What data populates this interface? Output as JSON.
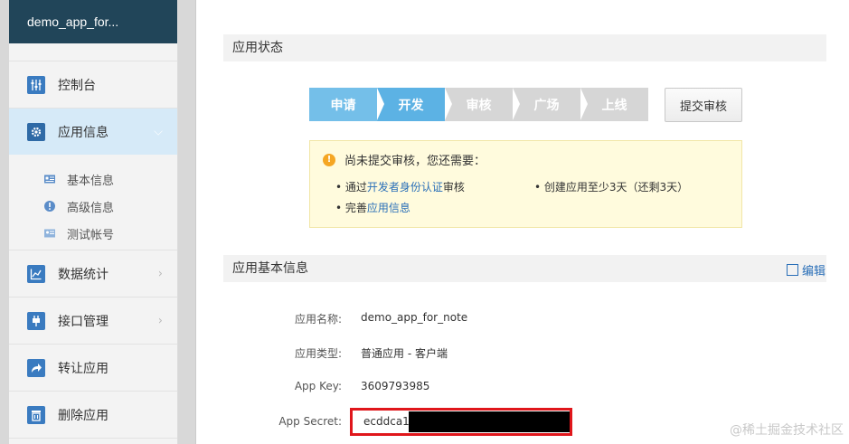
{
  "app": {
    "name": "demo_app_for..."
  },
  "sidebar": {
    "items": [
      {
        "label": "控制台",
        "icon": "sliders-icon"
      },
      {
        "label": "应用信息",
        "icon": "gear-icon"
      },
      {
        "label": "数据统计",
        "icon": "chart-icon"
      },
      {
        "label": "接口管理",
        "icon": "plug-icon"
      },
      {
        "label": "转让应用",
        "icon": "share-icon"
      },
      {
        "label": "删除应用",
        "icon": "trash-icon"
      }
    ],
    "sub_items": [
      {
        "label": "基本信息",
        "icon": "id-card-icon"
      },
      {
        "label": "高级信息",
        "icon": "info-icon"
      },
      {
        "label": "测试帐号",
        "icon": "test-account-icon"
      }
    ],
    "chevron_down": "⌵",
    "chevron_right": "›"
  },
  "status": {
    "title": "应用状态",
    "steps": [
      "申请",
      "开发",
      "审核",
      "广场",
      "上线"
    ],
    "submit_label": "提交审核",
    "notice": {
      "heading": "尚未提交审核，您还需要：",
      "req1_prefix": "• 通过",
      "req1_link": "开发者身份认证",
      "req1_suffix": "审核",
      "req2": "• 创建应用至少3天（还剩3天）",
      "req3_prefix": "• 完善",
      "req3_link": "应用信息"
    }
  },
  "basic": {
    "title": "应用基本信息",
    "edit_label": "编辑",
    "fields": [
      {
        "label": "应用名称:",
        "value": "demo_app_for_note"
      },
      {
        "label": "应用类型:",
        "value": "普通应用 - 客户端"
      },
      {
        "label": "App Key:",
        "value": "3609793985"
      },
      {
        "label": "App Secret:",
        "value": "ecddca1"
      }
    ]
  },
  "watermark": "@稀土掘金技术社区",
  "colors": {
    "header": "#214559",
    "accent": "#3a7bc0",
    "active_nav": "#d6eaf8",
    "step_done": "#74bfe9",
    "highlight_border": "#e0161b"
  }
}
